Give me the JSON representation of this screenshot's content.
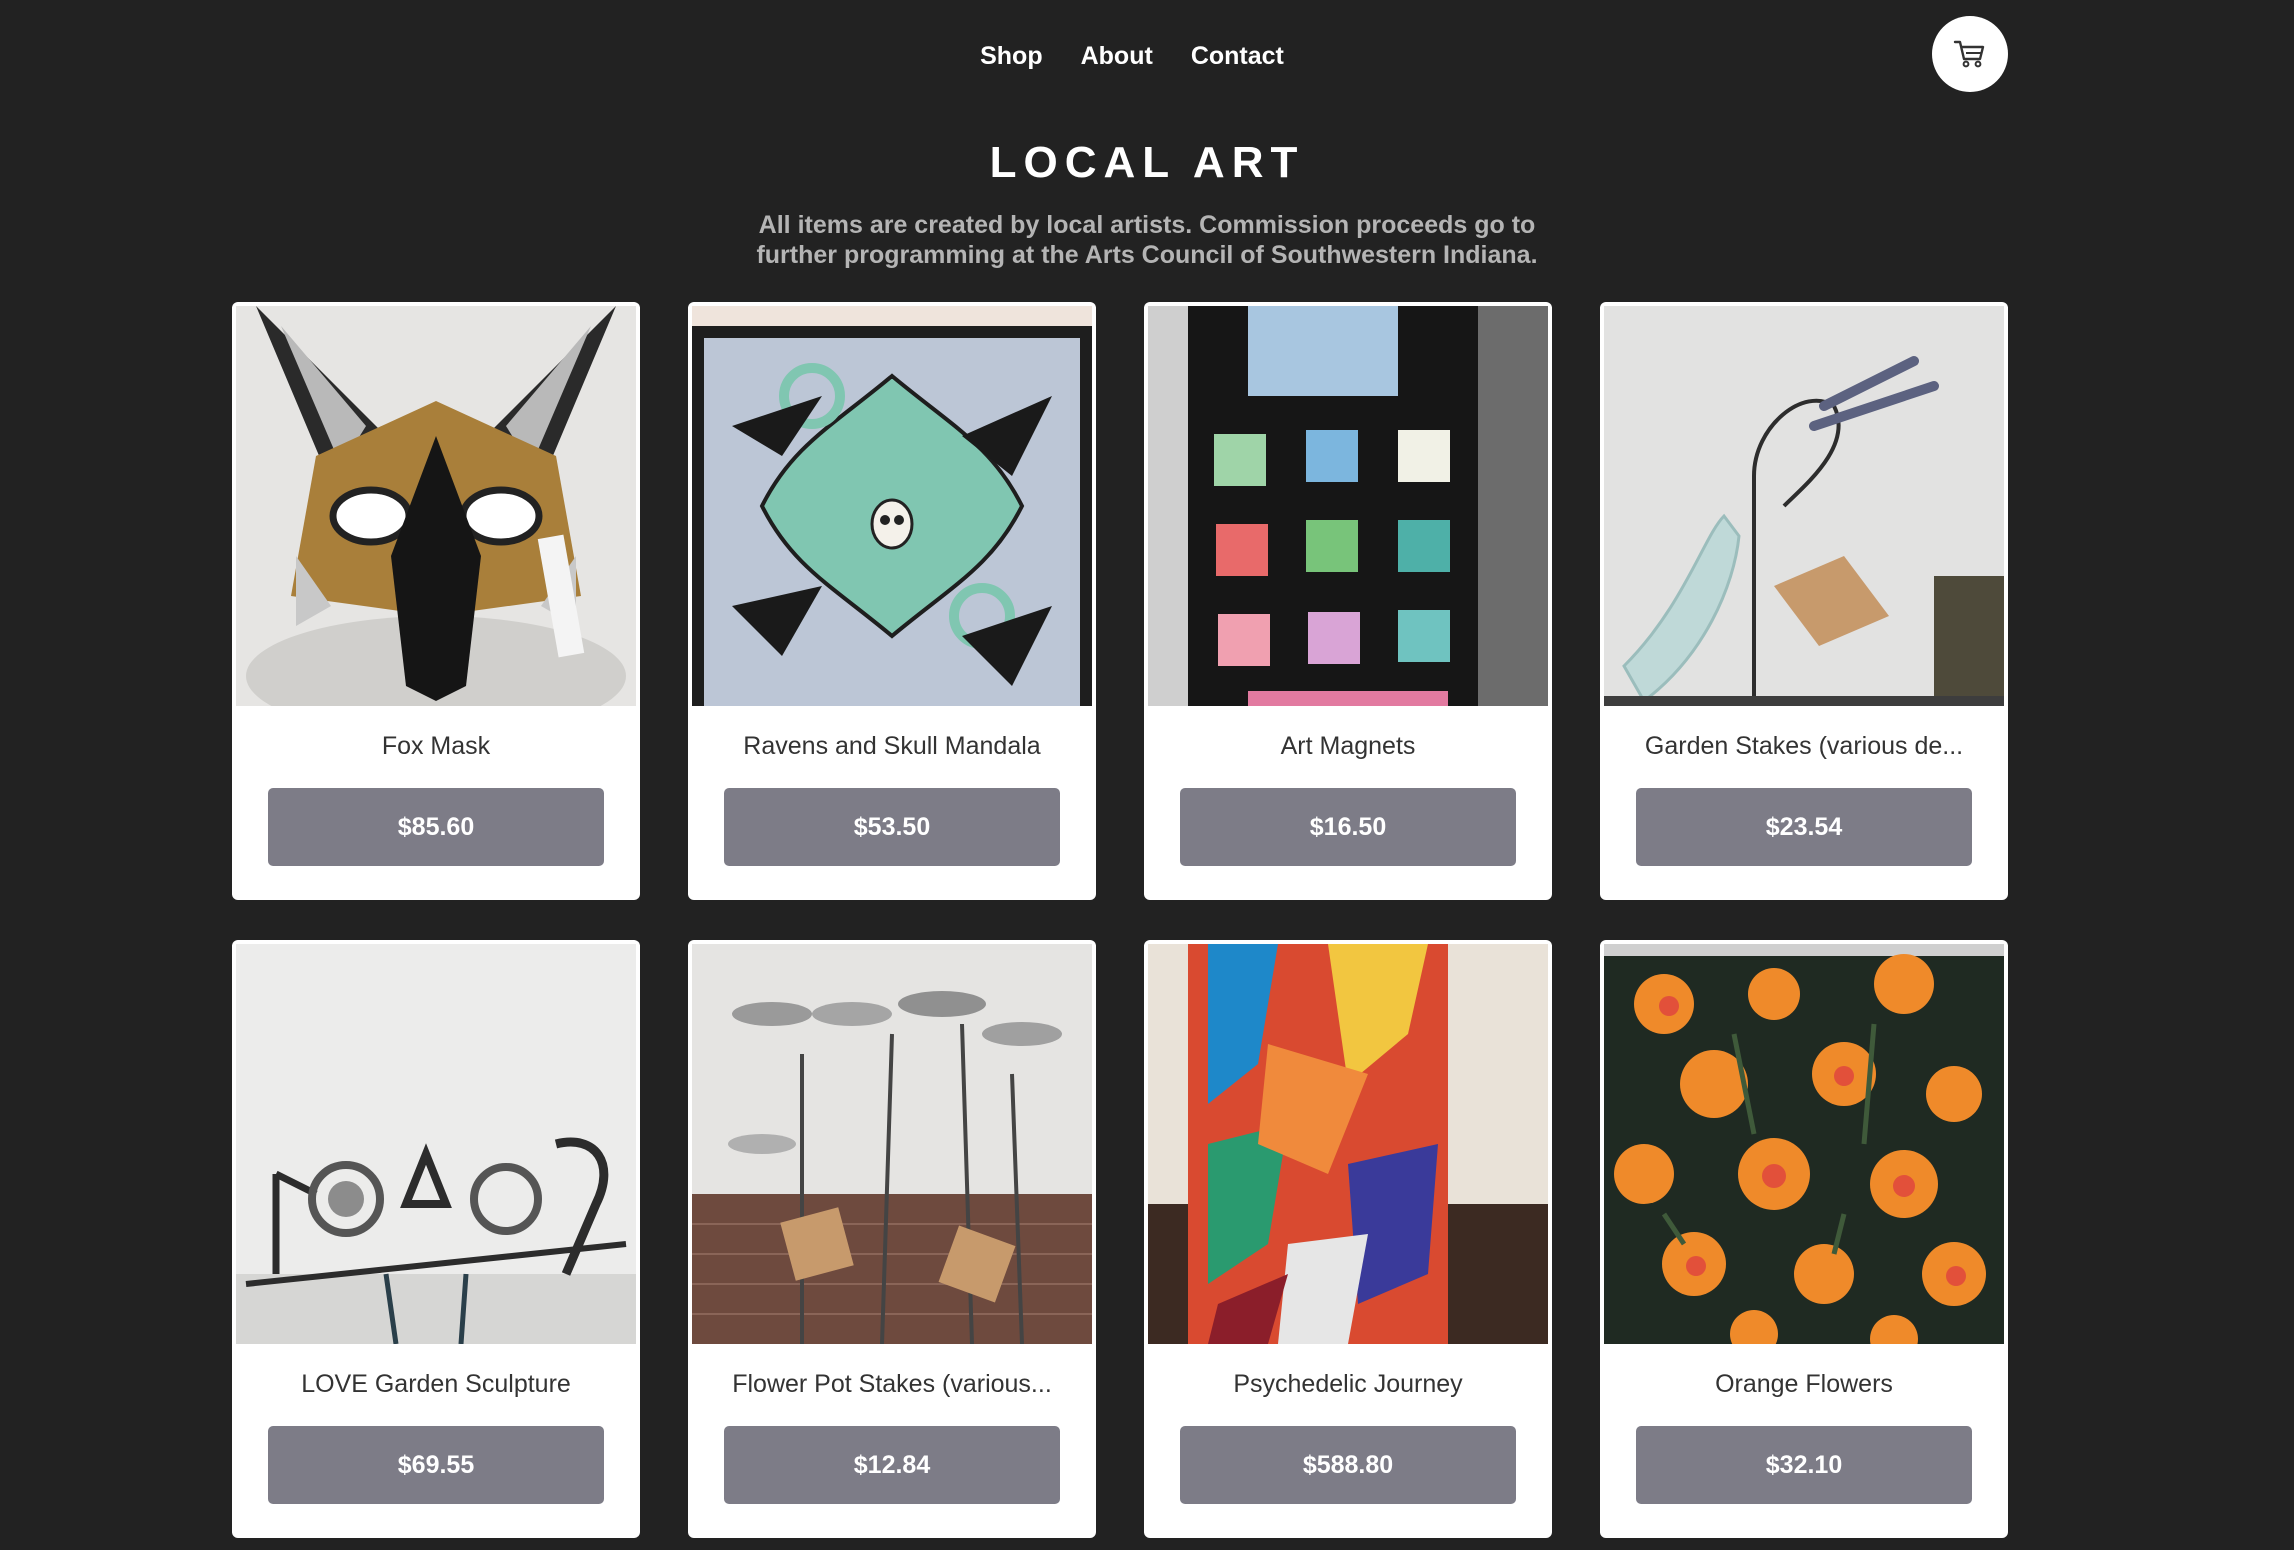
{
  "nav": {
    "shop": "Shop",
    "about": "About",
    "contact": "Contact",
    "cart_icon": "cart-icon"
  },
  "header": {
    "title": "LOCAL ART",
    "subtitle_line1": "All items are created by local artists. Commission proceeds go to",
    "subtitle_line2": "further programming at the Arts Council of Southwestern Indiana."
  },
  "products": [
    {
      "name": "Fox Mask",
      "price": "$85.60"
    },
    {
      "name": "Ravens and Skull Mandala",
      "price": "$53.50"
    },
    {
      "name": "Art Magnets",
      "price": "$16.50"
    },
    {
      "name": "Garden Stakes (various de...",
      "price": "$23.54"
    },
    {
      "name": "LOVE Garden Sculpture",
      "price": "$69.55"
    },
    {
      "name": "Flower Pot Stakes (various...",
      "price": "$12.84"
    },
    {
      "name": "Psychedelic Journey",
      "price": "$588.80"
    },
    {
      "name": "Orange Flowers",
      "price": "$32.10"
    }
  ],
  "colors": {
    "background": "#222222",
    "card": "#ffffff",
    "button": "#7d7c87",
    "subtitle": "#b4b4b4"
  }
}
